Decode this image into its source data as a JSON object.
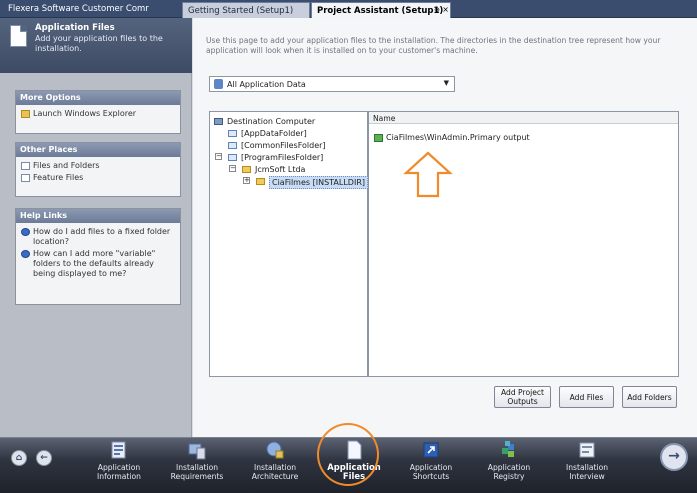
{
  "app": {
    "title": "Flexera Software Customer Comr",
    "tabs": [
      {
        "label": "Getting Started (Setup1)",
        "active": false
      },
      {
        "label": "Project Assistant (Setup1)",
        "active": true
      }
    ],
    "tab_pin_glyph": "⊕",
    "tab_close_glyph": "×"
  },
  "sidebar": {
    "header_title": "Application Files",
    "header_desc": "Add your application files to the installation.",
    "more_options": {
      "title": "More Options",
      "items": [
        "Launch Windows Explorer"
      ]
    },
    "other_places": {
      "title": "Other Places",
      "items": [
        "Files and Folders",
        "Feature Files"
      ]
    },
    "help_links": {
      "title": "Help Links",
      "items": [
        "How do I add files to a fixed folder location?",
        "How can I add more \"variable\" folders to the defaults already being displayed to me?"
      ]
    }
  },
  "main": {
    "intro": "Use this page to add your application files to the installation. The directories in the destination tree represent how your application will look when it is installed on to your customer's machine.",
    "dropdown_value": "All Application Data",
    "dropdown_arrow": "▼",
    "tree": [
      {
        "label": "Destination Computer",
        "kind": "computer"
      },
      {
        "label": "[AppDataFolder]",
        "kind": "variable"
      },
      {
        "label": "[CommonFilesFolder]",
        "kind": "variable"
      },
      {
        "label": "[ProgramFilesFolder]",
        "kind": "variable"
      },
      {
        "label": "JcmSoft Ltda",
        "kind": "folder"
      },
      {
        "label": "CiaFilmes [INSTALLDIR]",
        "kind": "selected"
      }
    ],
    "expander_minus": "−",
    "expander_plus": "+",
    "list_header": "Name",
    "list_items": [
      "CiaFilmes\\WinAdmin.Primary output"
    ],
    "buttons": {
      "add_outputs": "Add Project Outputs",
      "add_files": "Add Files",
      "add_folders": "Add Folders"
    }
  },
  "navbar": {
    "home_glyph": "⌂",
    "back_glyph": "←",
    "next_glyph": "→",
    "items": [
      {
        "label": "Application Information",
        "active": false
      },
      {
        "label": "Installation Requirements",
        "active": false
      },
      {
        "label": "Installation Architecture",
        "active": false
      },
      {
        "label": "Application Files",
        "active": true
      },
      {
        "label": "Application Shortcuts",
        "active": false
      },
      {
        "label": "Application Registry",
        "active": false
      },
      {
        "label": "Installation Interview",
        "active": false
      }
    ]
  },
  "colors": {
    "highlight_annotation": "#f08a2a",
    "sidebar_header": "#4a5872",
    "nav_bar": "#2f3440"
  }
}
